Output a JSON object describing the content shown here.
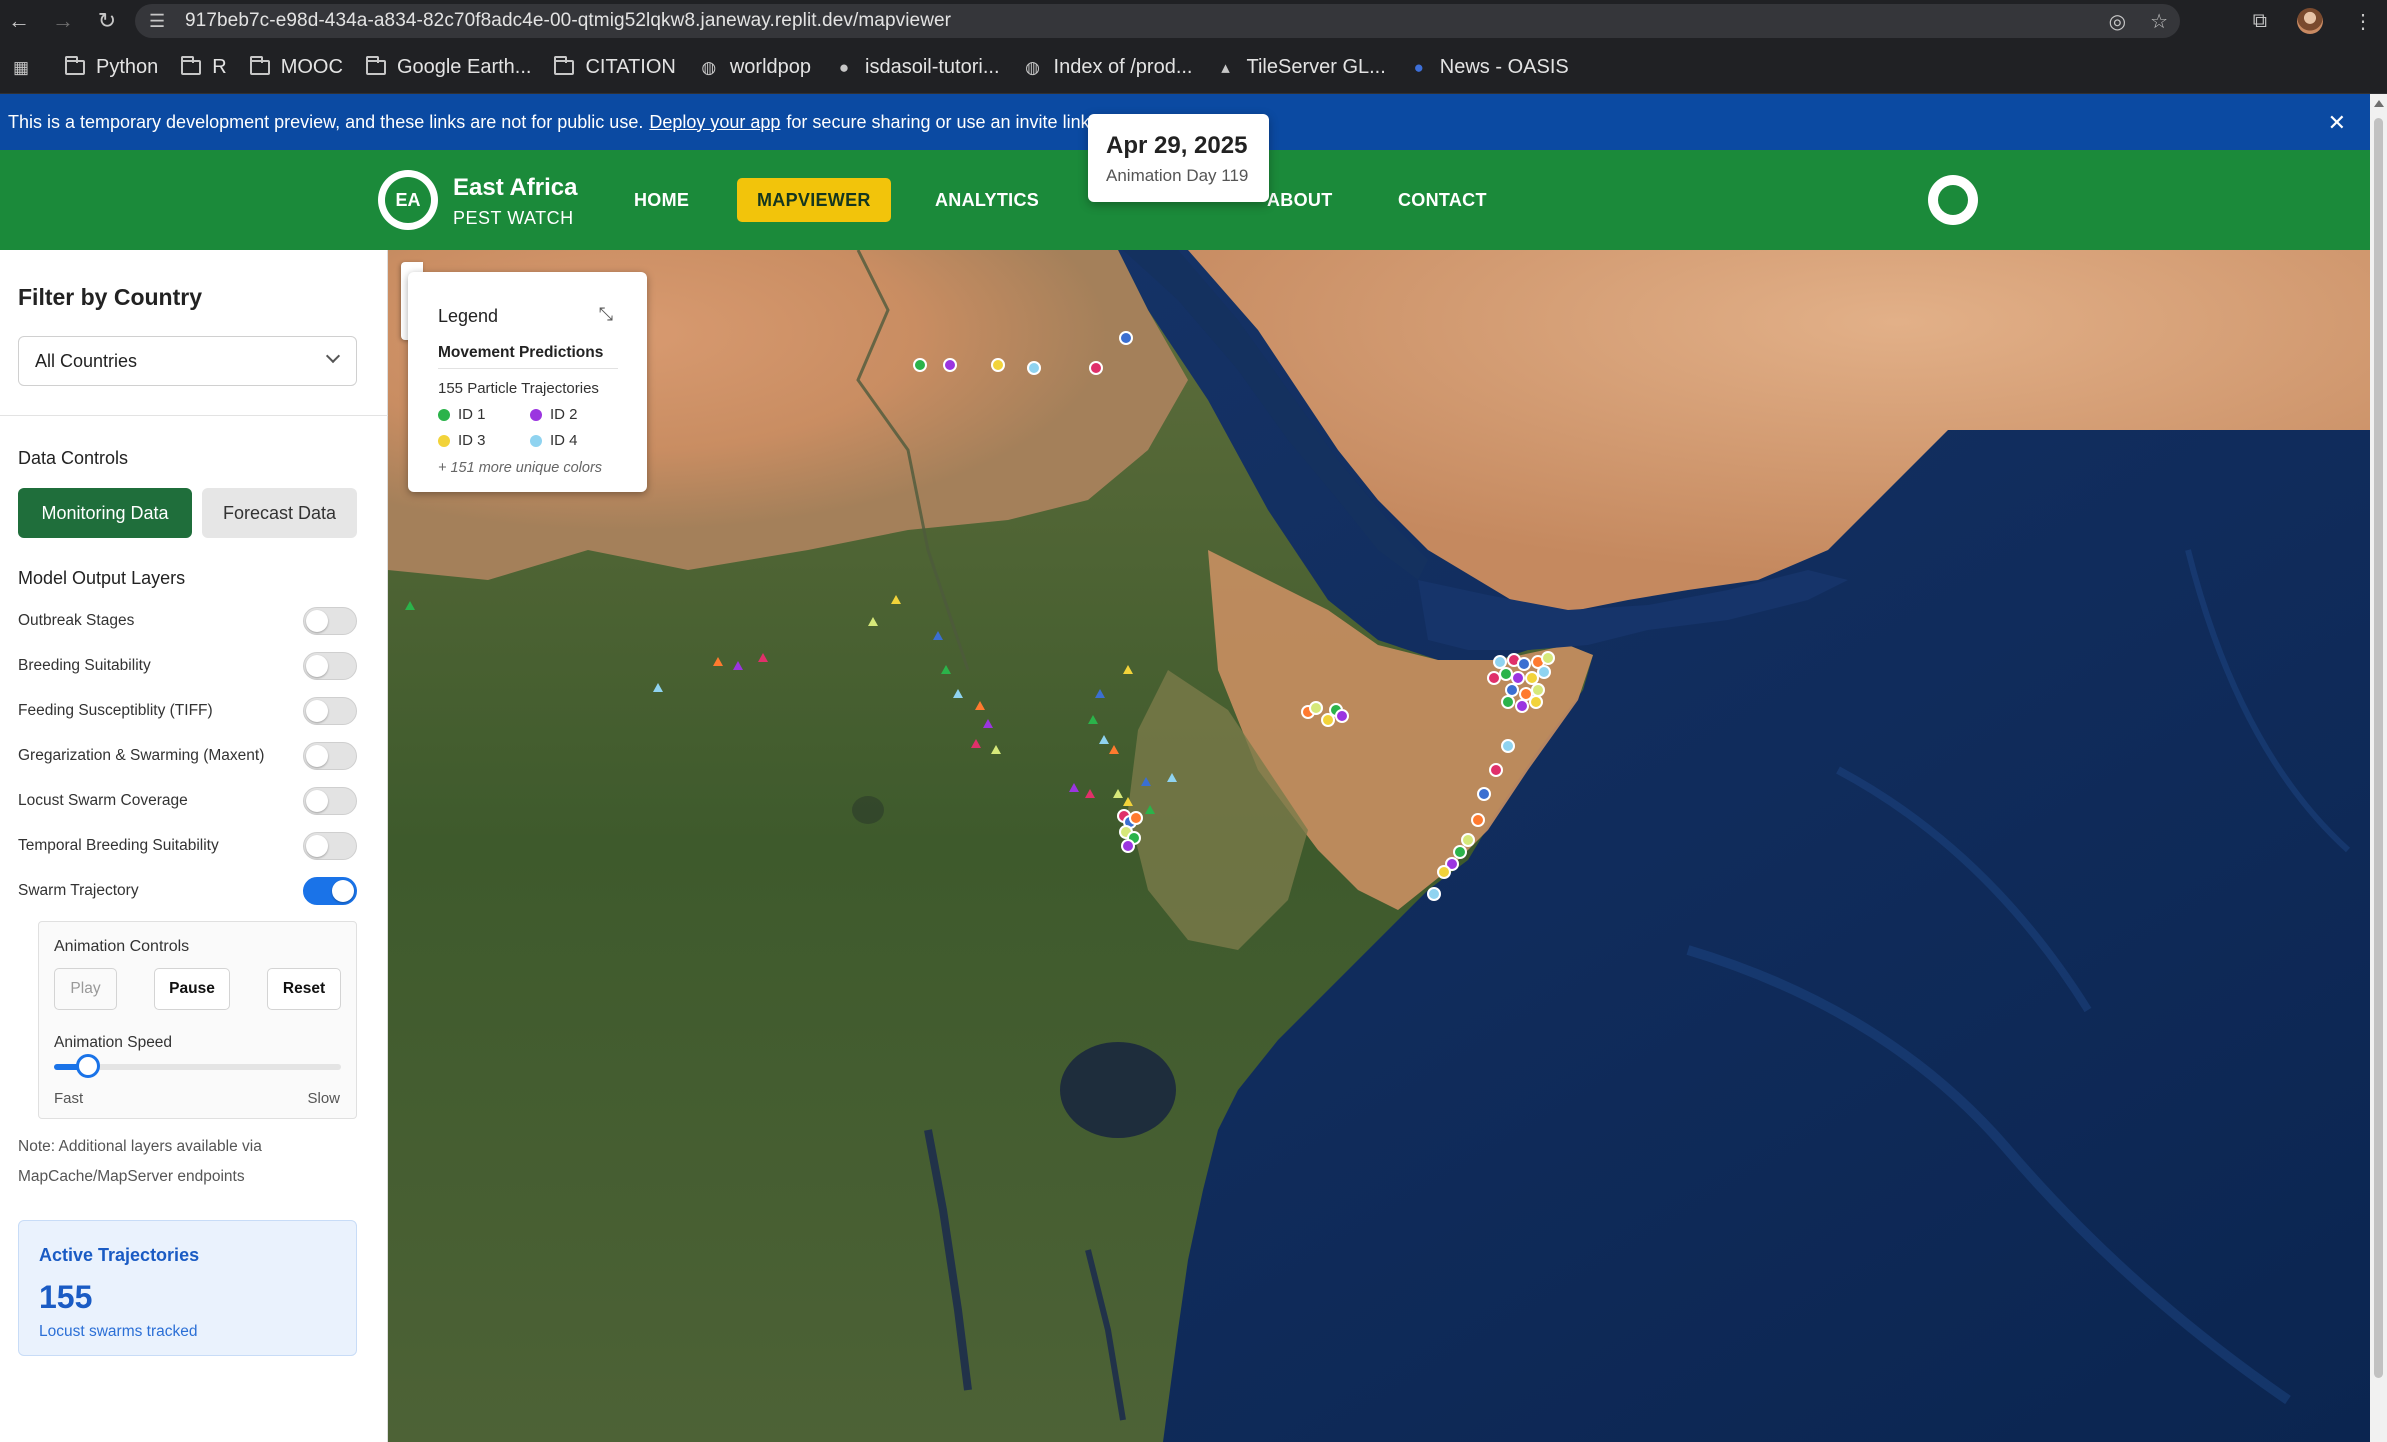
{
  "browser": {
    "url": "917beb7c-e98d-434a-a834-82c70f8adc4e-00-qtmig52lqkw8.janeway.replit.dev/mapviewer",
    "bookmarks": [
      {
        "label": "Python",
        "icon": "folder-icon"
      },
      {
        "label": "R",
        "icon": "folder-icon"
      },
      {
        "label": "MOOC",
        "icon": "folder-icon"
      },
      {
        "label": "Google Earth...",
        "icon": "folder-icon"
      },
      {
        "label": "CITATION",
        "icon": "folder-icon"
      },
      {
        "label": "worldpop",
        "icon": "globe-icon"
      },
      {
        "label": "isdasoil-tutori...",
        "icon": "github-icon"
      },
      {
        "label": "Index of /prod...",
        "icon": "globe-icon"
      },
      {
        "label": "TileServer GL...",
        "icon": "pin-icon"
      },
      {
        "label": "News - OASIS",
        "icon": "person-icon"
      }
    ]
  },
  "banner": {
    "text_before": "This is a temporary development preview, and these links are not for public use.",
    "link": "Deploy your app",
    "text_after": "for secure sharing or use an invite link."
  },
  "header": {
    "logo": "EA",
    "brand_title": "East Africa",
    "brand_subtitle": "PEST WATCH",
    "nav": {
      "home": "HOME",
      "mapviewer": "MAPVIEWER",
      "analytics": "ANALYTICS",
      "about": "ABOUT",
      "contact": "CONTACT"
    },
    "accent_color": "#1b8a3a",
    "active_color": "#f2c40b"
  },
  "date_popup": {
    "date": "Apr 29, 2025",
    "day": "Animation Day 119"
  },
  "sidebar": {
    "filter_title": "Filter by Country",
    "country_select": "All Countries",
    "data_controls_title": "Data Controls",
    "monitoring_button": "Monitoring Data",
    "forecast_button": "Forecast Data",
    "layers_title": "Model Output Layers",
    "layers": [
      {
        "label": "Outbreak Stages",
        "on": false
      },
      {
        "label": "Breeding Suitability",
        "on": false
      },
      {
        "label": "Feeding Susceptiblity (TIFF)",
        "on": false
      },
      {
        "label": "Gregarization & Swarming (Maxent)",
        "on": false
      },
      {
        "label": "Locust Swarm Coverage",
        "on": false
      },
      {
        "label": "Temporal Breeding Suitability",
        "on": false
      },
      {
        "label": "Swarm Trajectory",
        "on": true
      }
    ],
    "animation": {
      "title": "Animation Controls",
      "play": "Play",
      "pause": "Pause",
      "reset": "Reset",
      "speed_label": "Animation Speed",
      "fast": "Fast",
      "slow": "Slow",
      "speed_fraction": 0.12
    },
    "note": "Note: Additional layers available via MapCache/MapServer endpoints",
    "active": {
      "title": "Active Trajectories",
      "count": "155",
      "subtitle": "Locust swarms tracked"
    }
  },
  "legend": {
    "title": "Legend",
    "subtitle": "Movement Predictions",
    "count_text": "155 Particle Trajectories",
    "items": [
      {
        "label": "ID 1",
        "color": "#2bb34a"
      },
      {
        "label": "ID 2",
        "color": "#9b35e0"
      },
      {
        "label": "ID 3",
        "color": "#f2d33a"
      },
      {
        "label": "ID 4",
        "color": "#8fd3f0"
      }
    ],
    "more": "+ 151 more unique colors"
  }
}
